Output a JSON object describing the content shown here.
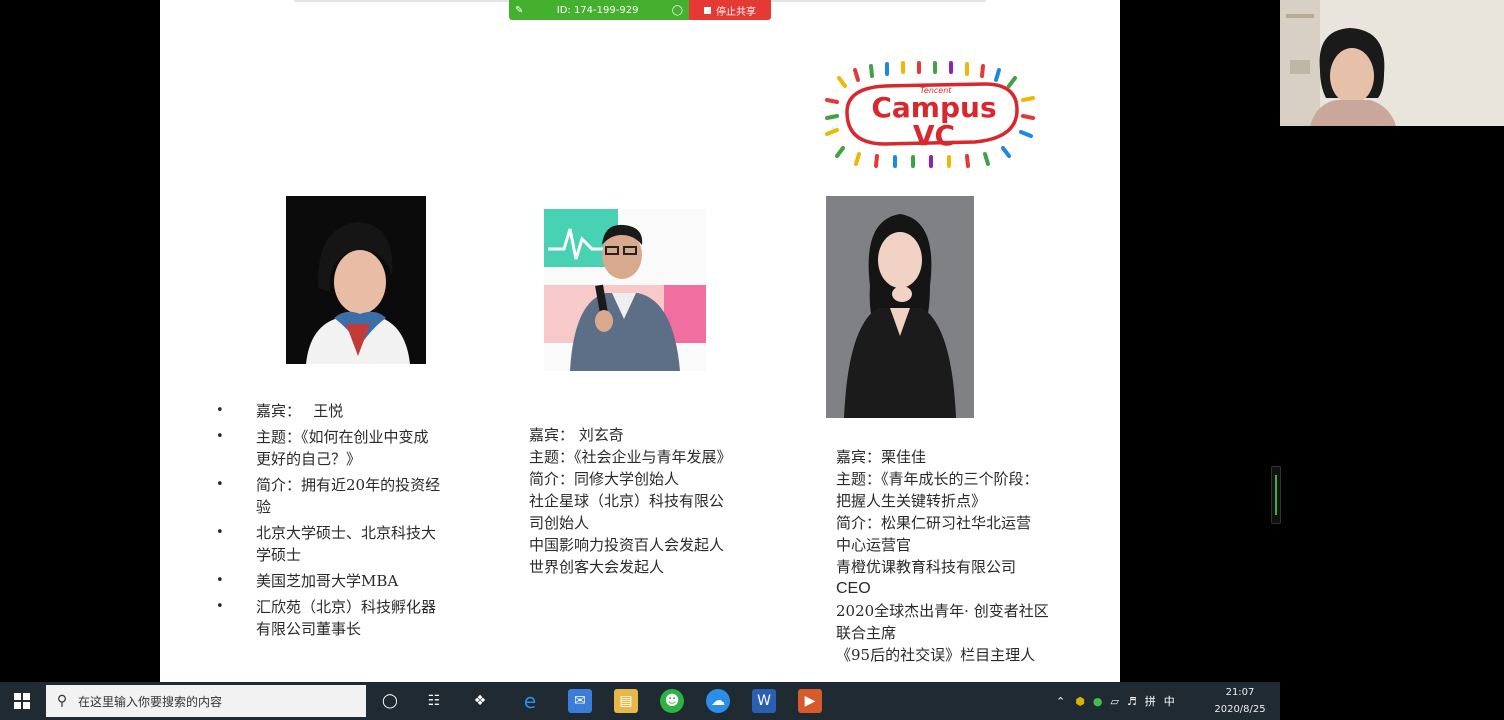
{
  "meeting_bar": {
    "id_text": "ID: 174-199-929",
    "stop_label": "停止共享"
  },
  "colors": {
    "meeting_green": "#45b02e",
    "stop_red": "#e53935",
    "taskbar": "#1f2a33",
    "logo_red": "#d8282d"
  },
  "logo": {
    "text": "Campus VC",
    "small_text": "Tencent"
  },
  "guests": [
    {
      "items": [
        {
          "label": "嘉宾：",
          "text": "王悦"
        },
        {
          "label": "主题：",
          "text": "《如何在创业中变成"
        },
        {
          "text": "更好的自己？》"
        },
        {
          "label": "简介：",
          "text": "拥有近20年的投资经"
        },
        {
          "text": "验"
        },
        {
          "text": "北京大学硕士、北京科技大"
        },
        {
          "text": "学硕士"
        },
        {
          "text": "美国芝加哥大学MBA"
        },
        {
          "text": "汇欣苑（北京）科技孵化器"
        },
        {
          "text": "有限公司董事长"
        }
      ]
    },
    {
      "lines": [
        "嘉宾： 刘玄奇",
        "主题：《社会企业与青年发展》",
        "简介：同修大学创始人",
        "社企星球（北京）科技有限公",
        "司创始人",
        "中国影响力投资百人会发起人",
        "世界创客大会发起人"
      ]
    },
    {
      "lines": [
        "嘉宾：栗佳佳",
        "主题：《青年成长的三个阶段：",
        "把握人生关键转折点》",
        "简介：松果仁研习社华北运营",
        "中心运营官",
        "青橙优课教育科技有限公司",
        "CEO",
        "2020全球杰出青年· 创变者社区",
        "联合主席",
        "《95后的社交误》栏目主理人"
      ]
    }
  ],
  "taskbar": {
    "search_placeholder": "在这里输入你要搜索的内容",
    "tray_lang": "中",
    "tray_ime": "拼",
    "clock_time": "21:07",
    "clock_date": "2020/8/25"
  },
  "icons": [
    "windows-icon",
    "search-icon",
    "task-view-icon",
    "file-explorer-icon",
    "edge-icon",
    "wechat-icon",
    "word-icon",
    "powerpoint-icon",
    "tencent-meeting-icon",
    "webcam-feed"
  ]
}
